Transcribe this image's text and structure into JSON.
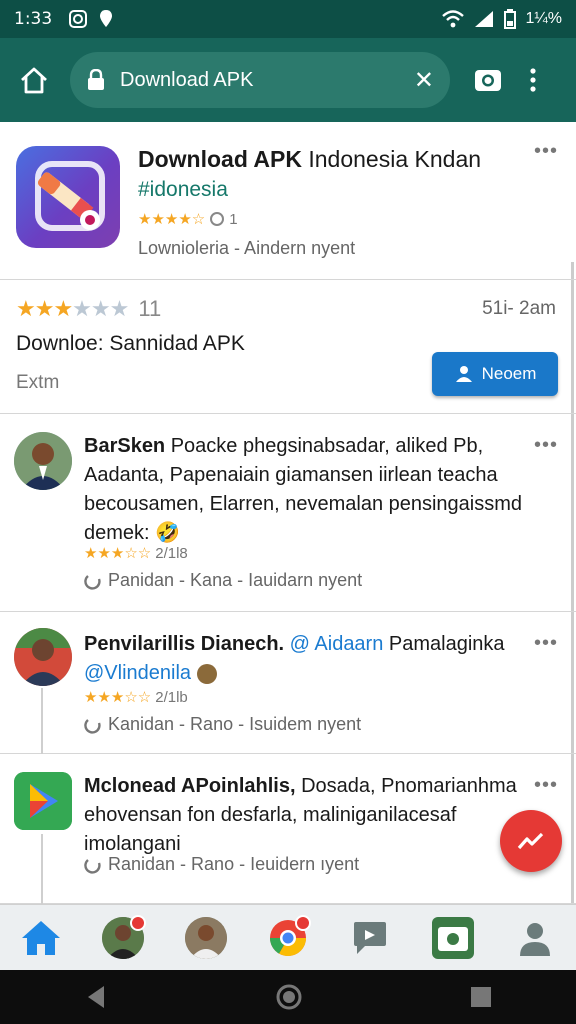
{
  "status_bar": {
    "time": "1:33",
    "battery": "1¼%"
  },
  "address_bar": {
    "url_text": "Download APK",
    "clear_glyph": "✕"
  },
  "top_card": {
    "title_bold": "Download APK",
    "title_rest": " Indonesia Kndan",
    "hashtag": "#idonesia",
    "stars": "★★★★☆",
    "comment_count": "1",
    "meta": "Lownioleria - Aindern nyent",
    "menu": "•••"
  },
  "download_card": {
    "stars": "★★★★★",
    "rating_count": "11",
    "time": "51i- 2am",
    "title": "Downloe: Sannidad APK",
    "subtitle": "Extm",
    "button_label": "Neoem"
  },
  "posts": [
    {
      "author": "BarSken",
      "text": " Poacke phegsinabsadar, aliked Pb, Aadanta, Papenaiain giamansen iirlean teacha becousamen, Elarren, nevemalan pensingaissmd demek: 🤣",
      "stars": "★★★☆☆",
      "count": "2/1l8",
      "meta": "Panidan - Kana - Iauidarn nyent",
      "menu": "•••"
    },
    {
      "author": "Penvilarillis Dianech.",
      "mention": " @ Aidaarn",
      "text_rest": " Pamalaginka",
      "mention2": "@Vlindenila",
      "stars": "★★★☆☆",
      "count": "2/1lb",
      "meta": "Kanidan - Rano - Isuidem nyent",
      "menu": "•••"
    },
    {
      "author": "Mclonead APoinlahlis,",
      "text": " Dosada, Pnomarianhma ehovensan fon desfarla, maliniganilacesaf imolangani",
      "meta": "Ranidan - Rano - Ieuidern ıyent",
      "menu": "•••"
    }
  ],
  "colors": {
    "header": "#17655a",
    "status": "#0d4f46",
    "accent": "#1a78c9",
    "fab": "#e53935",
    "star": "#f5a623"
  }
}
